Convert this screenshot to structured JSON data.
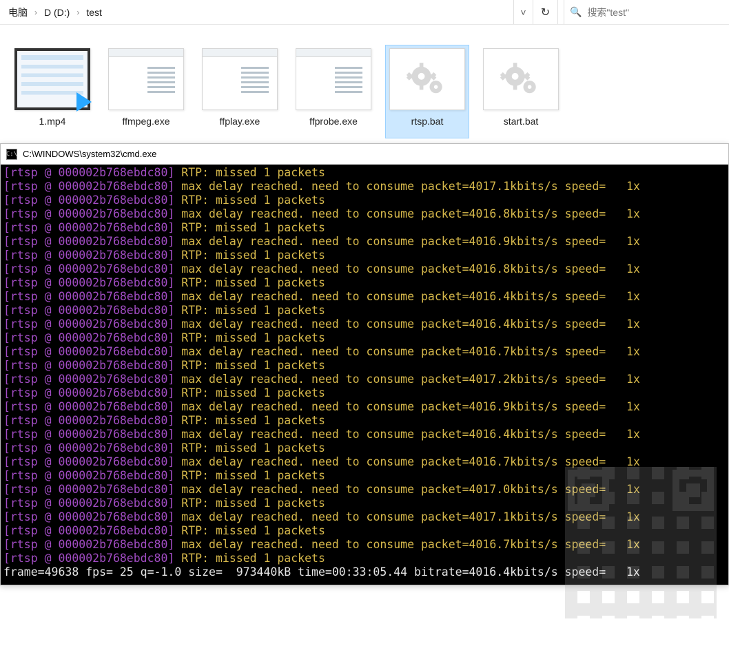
{
  "breadcrumb": {
    "item0": "电脑",
    "item1": "D (D:)",
    "item2": "test"
  },
  "search": {
    "placeholder": "搜索\"test\""
  },
  "files": {
    "f0": {
      "label": "1.mp4"
    },
    "f1": {
      "label": "ffmpeg.exe"
    },
    "f2": {
      "label": "ffplay.exe"
    },
    "f3": {
      "label": "ffprobe.exe"
    },
    "f4": {
      "label": "rtsp.bat"
    },
    "f5": {
      "label": "start.bat"
    }
  },
  "console": {
    "title": "C:\\WINDOWS\\system32\\cmd.exe",
    "tag": "[rtsp @ 000002b768ebdc80]",
    "missed": "RTP: missed 1 packets",
    "delay_prefix": "max delay reached. need to consume packet=",
    "delay_suffix": "kbits/s speed=   1x",
    "rates": {
      "r0": "4017.1",
      "r1": "4016.8",
      "r2": "4016.9",
      "r3": "4016.8",
      "r4": "4016.4",
      "r5": "4016.4",
      "r6": "4016.7",
      "r7": "4017.2",
      "r8": "4016.9",
      "r9": "4016.4",
      "r10": "4016.7",
      "r11": "4017.0",
      "r12": "4017.1",
      "r13": "4016.7"
    },
    "status": "frame=49638 fps= 25 q=-1.0 size=  973440kB time=00:33:05.44 bitrate=4016.4kbits/s speed=   1x"
  }
}
